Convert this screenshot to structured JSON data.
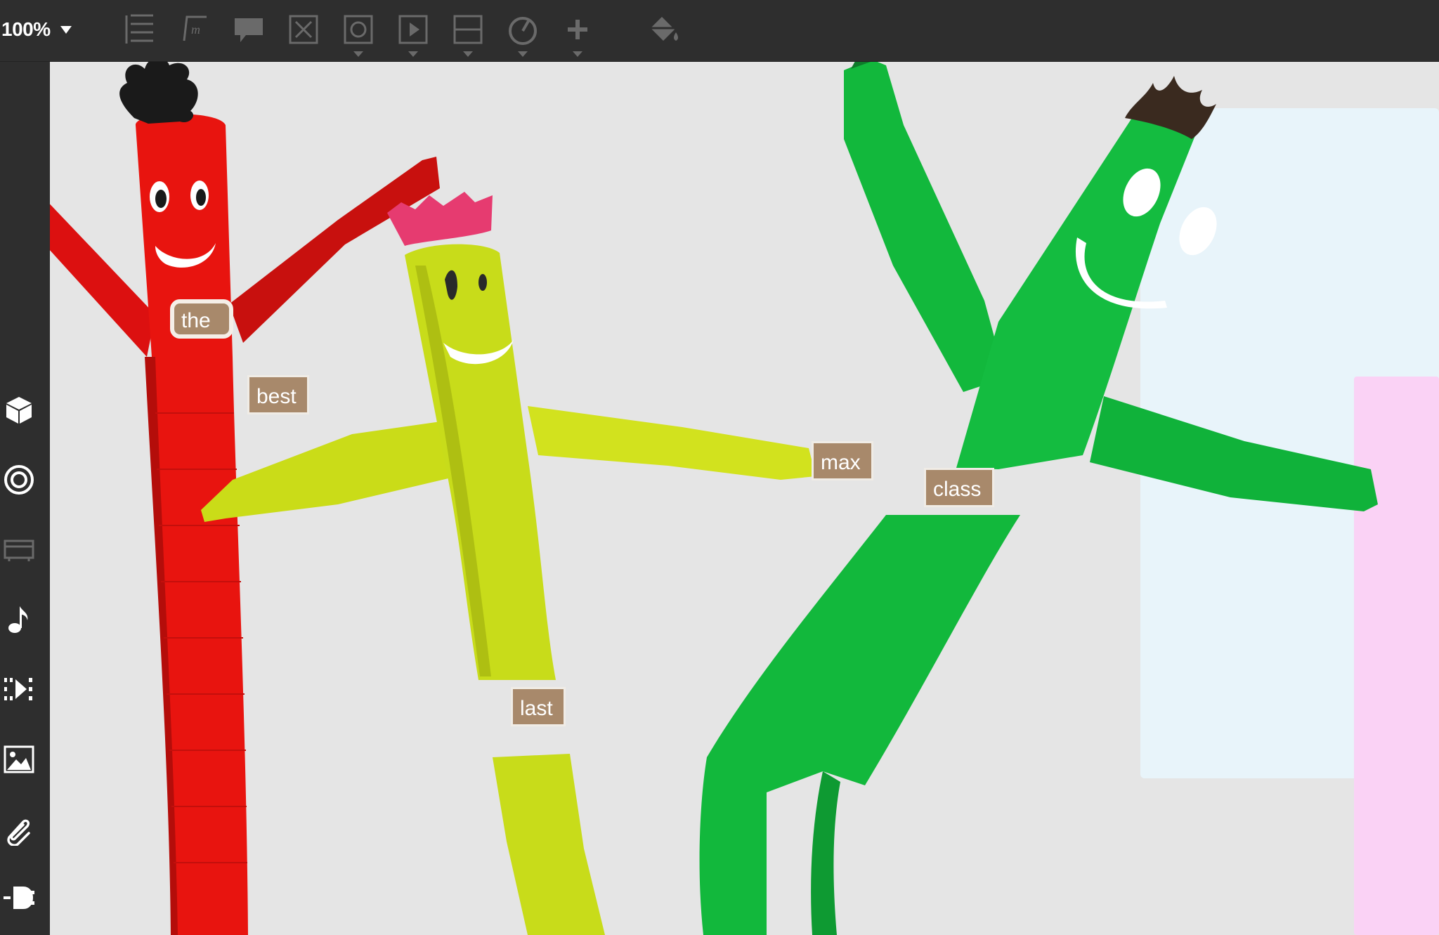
{
  "toolbar": {
    "zoom": "100%",
    "tools": [
      {
        "name": "text-tool-icon"
      },
      {
        "name": "math-tool-icon"
      },
      {
        "name": "comment-tool-icon"
      },
      {
        "name": "delete-box-tool-icon"
      },
      {
        "name": "shape-tool-icon"
      },
      {
        "name": "media-tool-icon"
      },
      {
        "name": "divider-tool-icon"
      },
      {
        "name": "timer-tool-icon"
      },
      {
        "name": "add-tool-icon"
      },
      {
        "name": "paint-bucket-icon"
      }
    ]
  },
  "sidebar": {
    "items": [
      {
        "name": "cube-icon"
      },
      {
        "name": "target-icon"
      },
      {
        "name": "frame-icon"
      },
      {
        "name": "music-note-icon"
      },
      {
        "name": "sequence-icon"
      },
      {
        "name": "image-icon"
      },
      {
        "name": "paperclip-icon"
      },
      {
        "name": "plugin-icon"
      }
    ]
  },
  "canvas": {
    "background": "#e5e5e5",
    "figures": [
      {
        "name": "red-tube-dancer",
        "color": "#e8140f"
      },
      {
        "name": "yellow-tube-dancer",
        "color": "#c8dc1a"
      },
      {
        "name": "green-tube-dancer",
        "color": "#12b83c"
      }
    ],
    "panels": [
      {
        "name": "light-blue-panel",
        "color": "#e8f4fa"
      },
      {
        "name": "pink-panel",
        "color": "#fad2f5"
      }
    ],
    "words": [
      {
        "text": "the",
        "selected": true
      },
      {
        "text": "best",
        "selected": false
      },
      {
        "text": "max",
        "selected": false
      },
      {
        "text": "class",
        "selected": false
      },
      {
        "text": "last",
        "selected": false
      }
    ]
  }
}
